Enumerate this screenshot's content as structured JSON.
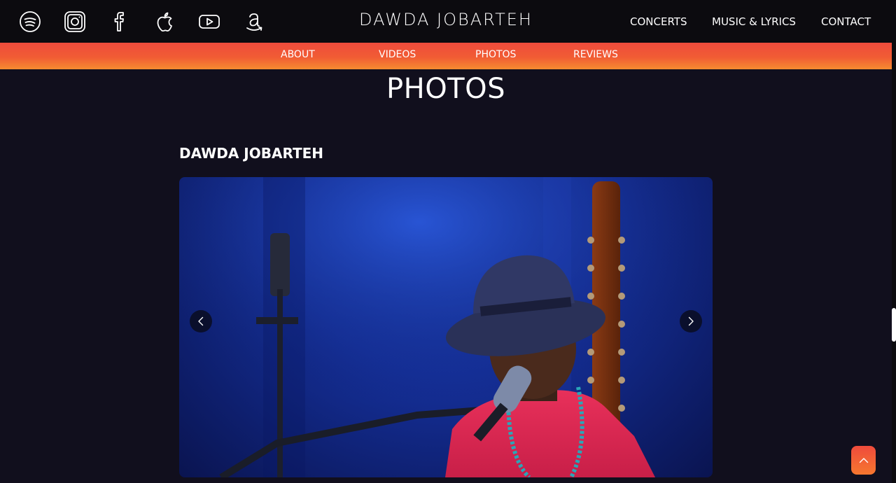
{
  "header": {
    "logo_text": "DAWDA JOBARTEH",
    "social_icons": [
      "spotify-icon",
      "instagram-icon",
      "facebook-icon",
      "apple-icon",
      "youtube-icon",
      "amazon-icon"
    ],
    "main_nav": [
      "CONCERTS",
      "MUSIC & LYRICS",
      "CONTACT"
    ]
  },
  "subnav": {
    "items": [
      "ABOUT",
      "VIDEOS",
      "PHOTOS",
      "REVIEWS"
    ],
    "gradient_colors": [
      "#ef4b3c",
      "#f68c30"
    ]
  },
  "main": {
    "page_title": "PHOTOS",
    "section_title": "DAWDA JOBARTEH"
  },
  "gallery": {
    "prev_icon": "chevron-left-icon",
    "next_icon": "chevron-right-icon"
  },
  "back_to_top_icon": "chevron-up-icon",
  "colors": {
    "background": "#110f1d",
    "header": "#0c0b0f",
    "accent": "#f15c34"
  }
}
